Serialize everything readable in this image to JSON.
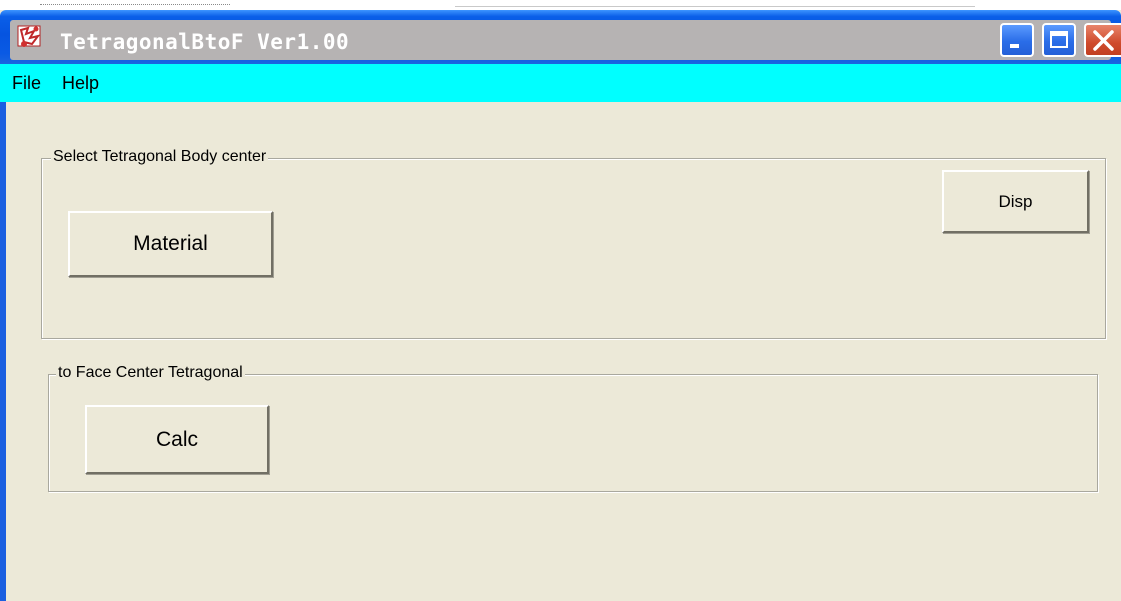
{
  "window": {
    "title": "TetragonalBtoF Ver1.00"
  },
  "menu": {
    "items": [
      "File",
      "Help"
    ]
  },
  "groups": [
    {
      "label": "Select Tetragonal Body center",
      "buttons": [
        "Material",
        "Disp"
      ]
    },
    {
      "label": "to Face Center Tetragonal",
      "buttons": [
        "Calc"
      ]
    }
  ],
  "icons": {
    "app": "app-icon",
    "minimize": "minimize-icon",
    "maximize": "maximize-icon",
    "close": "close-icon"
  },
  "colors": {
    "titlebar": "#0654e0",
    "menubar": "#00ffff",
    "client": "#ece9d8",
    "close_button": "#cf4a2c"
  }
}
